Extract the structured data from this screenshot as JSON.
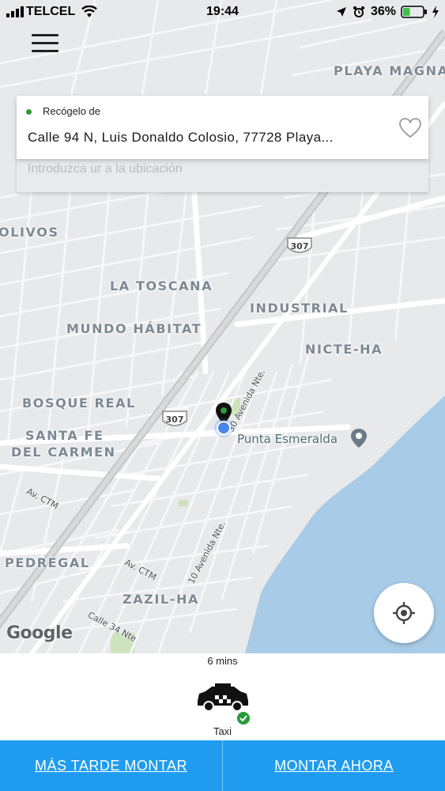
{
  "status_bar": {
    "carrier": "TELCEL",
    "time": "19:44",
    "battery_percent": "36%",
    "battery_level": 0.36,
    "icons": [
      "signal-icon",
      "wifi-icon",
      "location-arrow-icon",
      "alarm-icon",
      "battery-icon",
      "charging-icon"
    ]
  },
  "header": {
    "menu_icon": "hamburger-menu-icon"
  },
  "search": {
    "pickup_label": "Recógelo de",
    "pickup_address": "Calle 94 N, Luis Donaldo Colosio, 77728 Playa...",
    "destination_placeholder": "Introduzca ur a la ubicación",
    "favorite_icon": "heart-icon"
  },
  "map": {
    "neighborhoods": [
      "PLAYA MAGNA",
      "OLIVOS",
      "LA TOSCANA",
      "INDUSTRIAL",
      "MUNDO HÁBITAT",
      "NICTE-HA",
      "BOSQUE REAL",
      "SANTA FE",
      "DEL CARMEN",
      "PEDREGAL",
      "ZAZIL-HA"
    ],
    "streets": [
      "Av. CTM",
      "Av. CTM",
      "10 Avenida Nte.",
      "Calle 34 Nte",
      "30 Avenida Nte."
    ],
    "highway_shields": [
      "307",
      "307"
    ],
    "poi": "Punta Esmeralda",
    "attribution": "Google",
    "colors": {
      "land": "#e8e9eb",
      "roads": "#ffffff",
      "water": "#a8cce8",
      "park": "#cde3bd",
      "user_location": "#4a86e8"
    }
  },
  "locate_button": {
    "icon": "crosshair-locate-icon"
  },
  "ride_option": {
    "eta": "6 mins",
    "label": "Taxi",
    "icon": "taxi-car-icon",
    "selected_icon": "check-icon"
  },
  "actions": {
    "later": "MÁS TARDE MONTAR",
    "now": "MONTAR AHORA",
    "color": "#1f9cf0"
  }
}
